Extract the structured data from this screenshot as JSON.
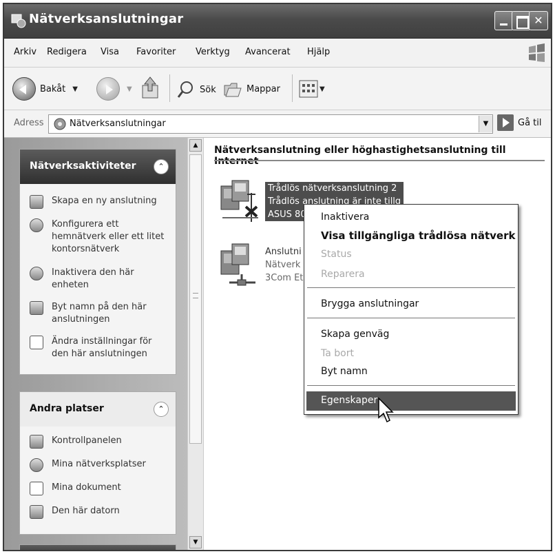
{
  "window": {
    "title": "Nätverksanslutningar"
  },
  "menubar": {
    "items": [
      "Arkiv",
      "Redigera",
      "Visa",
      "Favoriter",
      "Verktyg",
      "Avancerat",
      "Hjälp"
    ]
  },
  "toolbar": {
    "back_label": "Bakåt",
    "search_label": "Sök",
    "folders_label": "Mappar"
  },
  "address": {
    "label": "Adress",
    "value": "Nätverksanslutningar",
    "go_label": "Gå til"
  },
  "taskpane": {
    "network_tasks": {
      "title": "Nätverksaktiviteter",
      "items": [
        "Skapa en ny anslutning",
        "Konfigurera ett hemnätverk eller ett litet kontorsnätverk",
        "Inaktivera den här enheten",
        "Byt namn på den här anslutningen",
        "Ändra inställningar för den här anslutningen"
      ]
    },
    "other_places": {
      "title": "Andra platser",
      "items": [
        "Kontrollpanelen",
        "Mina nätverksplatser",
        "Mina dokument",
        "Den här datorn"
      ]
    }
  },
  "main": {
    "group_header": "Nätverksanslutning eller höghastighetsanslutning till Internet",
    "connections": [
      {
        "name": "Trådlös nätverksanslutning 2",
        "line2": "Trådlös anslutning är inte tillg",
        "line3": "ASUS 80"
      },
      {
        "name": "Anslutni",
        "line2": "Nätverk",
        "line3": "3Com Et"
      }
    ]
  },
  "context_menu": {
    "items": [
      {
        "label": "Inaktivera",
        "state": "normal"
      },
      {
        "label": "Visa tillgängliga trådlösa nätverk",
        "state": "default"
      },
      {
        "label": "Status",
        "state": "disabled"
      },
      {
        "label": "Reparera",
        "state": "disabled"
      },
      {
        "label": "Brygga anslutningar",
        "state": "normal"
      },
      {
        "label": "Skapa genväg",
        "state": "normal"
      },
      {
        "label": "Ta bort",
        "state": "disabled"
      },
      {
        "label": "Byt namn",
        "state": "normal"
      },
      {
        "label": "Egenskaper",
        "state": "highlighted"
      }
    ]
  },
  "icons": {
    "window": "network-connections-icon",
    "back": "back-arrow-icon",
    "forward": "forward-arrow-icon",
    "up": "up-folder-icon",
    "search": "search-icon",
    "folders": "folders-icon",
    "views": "views-icon",
    "collapse": "chevron-up-icon",
    "go": "go-arrow-icon"
  }
}
